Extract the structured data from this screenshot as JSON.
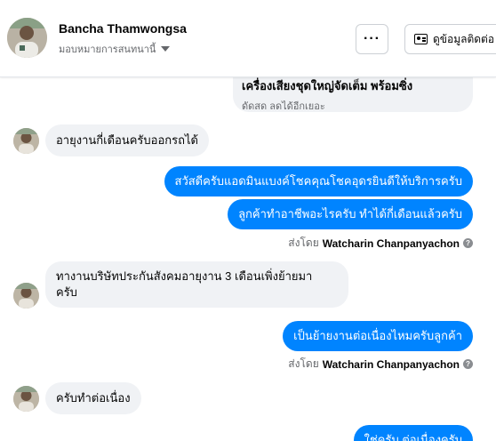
{
  "header": {
    "contact_name": "Bancha Thamwongsa",
    "assign_label": "มอบหมายการสนทนานี้",
    "more_label": "···",
    "profile_button_label": "ดูข้อมูลติดต่อ"
  },
  "preview_card": {
    "title": "เครื่องเสียงชุดใหญ่จัดเต็ม พร้อมซิ่ง",
    "subtitle": "ดัดสด ลดได้อีกเยอะ"
  },
  "messages": [
    {
      "direction": "in",
      "text": "อายุงานกี่เดือนครับออกรถได้"
    },
    {
      "direction": "out",
      "text": "สวัสดีครับแอดมินแบงค์โชคคุณโชคอุดรยินดีให้บริการครับ"
    },
    {
      "direction": "out",
      "text": "ลูกค้าทำอาชีพอะไรครับ ทำได้กี่เดือนแล้วครับ"
    },
    {
      "direction": "in",
      "line1": "ทางานบริษัทประกันสังคมอายุงาน 3 เดือนเพิ่งย้ายมา",
      "line2": "ครับ"
    },
    {
      "direction": "out",
      "text": "เป็นย้ายงานต่อเนื่องไหมครับลูกค้า"
    },
    {
      "direction": "in",
      "text": "ครับทำต่อเนื่อง"
    },
    {
      "direction": "out",
      "text": "ใช่ครับ ต่อเนื่องครับ"
    }
  ],
  "sent_by": {
    "prefix": "ส่งโดย",
    "agent": "Watcharin Chanpanyachon",
    "help_icon": "?"
  }
}
